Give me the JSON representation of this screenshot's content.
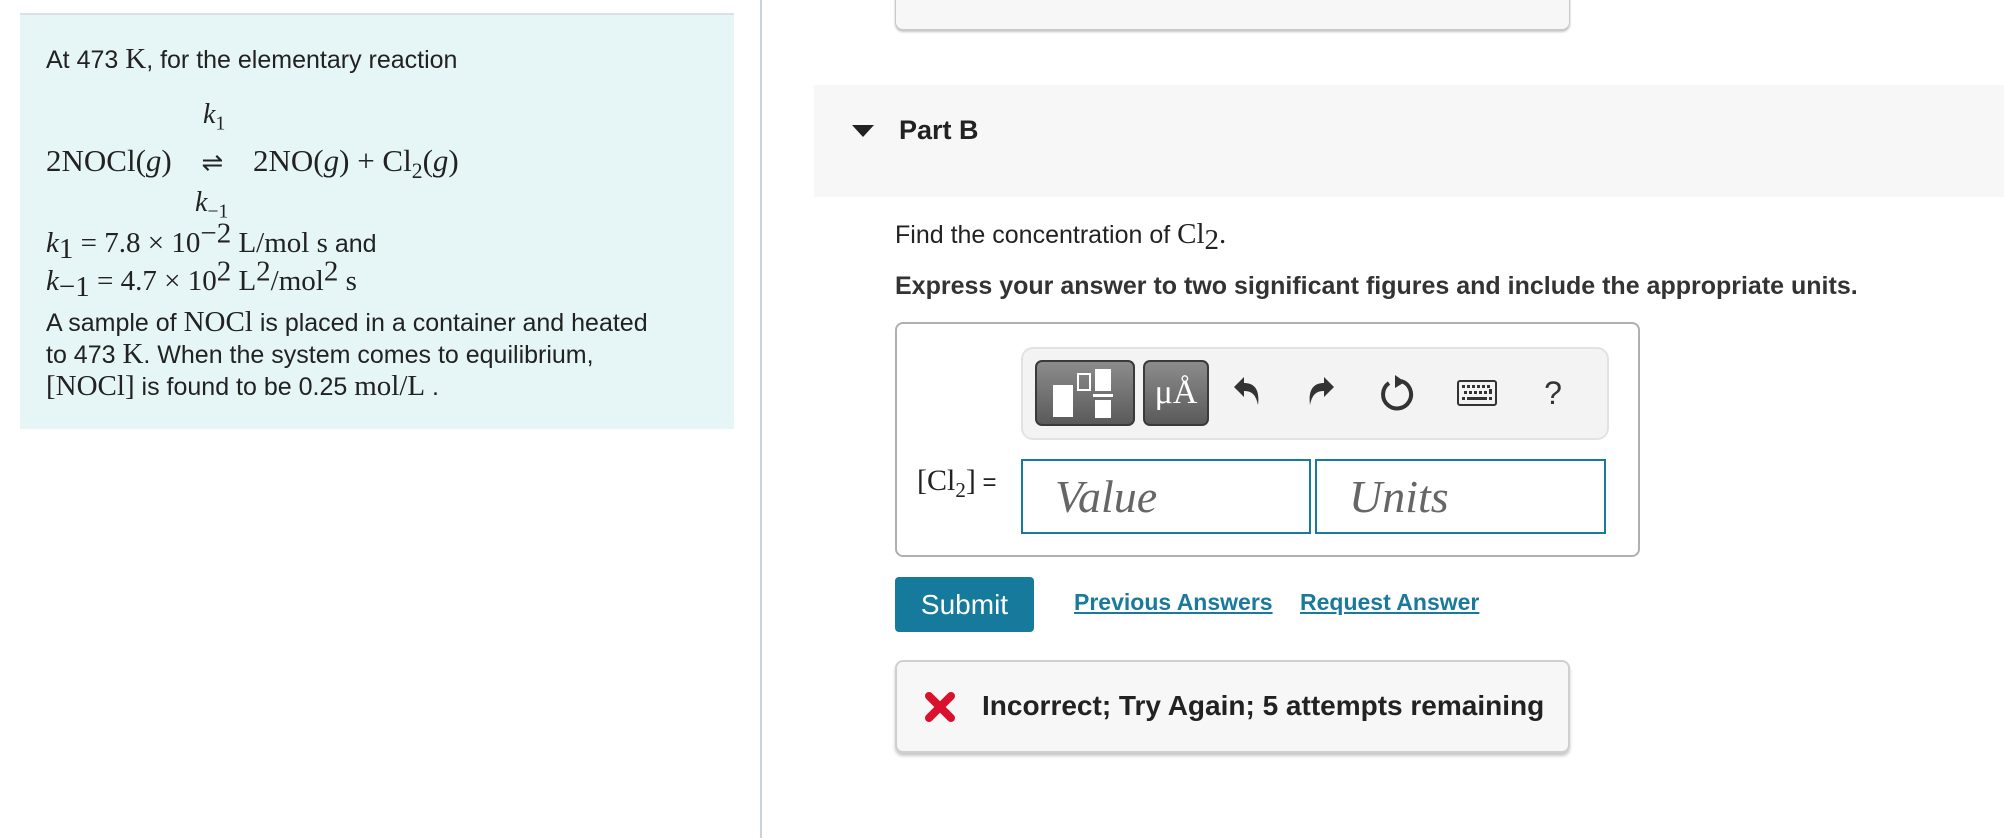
{
  "problem": {
    "intro_prefix": "At 473 ",
    "intro_unit": "K",
    "intro_suffix": ", for the elementary reaction",
    "reaction": {
      "forward_constant": "k",
      "forward_sub": "1",
      "reverse_constant": "k",
      "reverse_sub": "−1",
      "reactants": "2NOCl(",
      "reactant_phase": "g",
      "arrow": "⇌",
      "products_1": "2NO(",
      "product_1_phase": "g",
      "plus": ") + Cl",
      "product_2_sub": "2",
      "product_2_open": "(",
      "product_2_phase": "g",
      "close": ")",
      "reactant_close": ")"
    },
    "k1_line": {
      "symbol": "k",
      "sub": "1",
      "equals": " = 7.8 × 10",
      "exp": "−2",
      "unit": " L/mol s",
      "suffix": " and"
    },
    "km1_line": {
      "symbol": "k",
      "sub": "−1",
      "equals": " = 4.7 × 10",
      "exp": "2",
      "unit_a": " L",
      "unit_a_exp": "2",
      "unit_b": "/mol",
      "unit_b_exp": "2",
      "unit_c": " s"
    },
    "sample_line1_a": "A sample of ",
    "sample_species": "NOCl",
    "sample_line1_b": " is placed in a container and heated",
    "sample_line2_a": "to 473 ",
    "sample_line2_unit": "K",
    "sample_line2_b": ". When the system comes to equilibrium,",
    "sample_line3_species": "[NOCl]",
    "sample_line3_b": " is found to be 0.25 ",
    "sample_line3_unit": "mol/L",
    "sample_line3_end": " ."
  },
  "part_b": {
    "title": "Part B",
    "question_prefix": "Find the concentration of ",
    "question_species": "Cl",
    "question_sub": "2",
    "question_end": ".",
    "instruction": "Express your answer to two significant figures and include the appropriate units.",
    "answer": {
      "label_open": "[Cl",
      "label_sub": "2",
      "label_close": "]",
      "label_eq": " =",
      "value_placeholder": "Value",
      "value": "",
      "units_placeholder": "Units",
      "units": ""
    },
    "toolbar": {
      "templates_icon": "fraction-template-icon",
      "units_symbol": "μÅ",
      "undo_icon": "undo-icon",
      "redo_icon": "redo-icon",
      "reset_icon": "reset-icon",
      "keyboard_icon": "keyboard-icon",
      "help_label": "?"
    },
    "submit_label": "Submit",
    "previous_answers_label": "Previous Answers",
    "request_answer_label": "Request Answer",
    "feedback": {
      "text": "Incorrect; Try Again; 5 attempts remaining",
      "status_color": "#d9112c"
    }
  },
  "colors": {
    "accent": "#157a9b",
    "problem_bg": "#e6f6f7",
    "header_bg": "#f7f7f7",
    "error": "#d9112c"
  }
}
